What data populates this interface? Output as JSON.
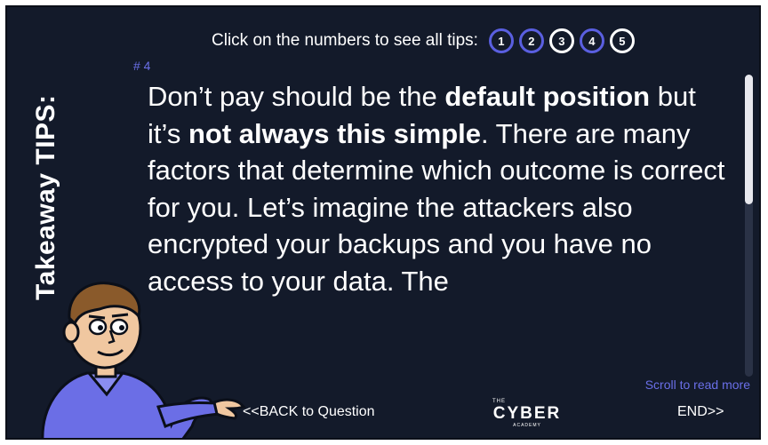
{
  "sidebar": {
    "title": "Takeaway TIPS:"
  },
  "header": {
    "label": "Click on the numbers to see all tips:",
    "numbers": [
      {
        "label": "1",
        "state": "current"
      },
      {
        "label": "2",
        "state": "current"
      },
      {
        "label": "3",
        "state": "visited"
      },
      {
        "label": "4",
        "state": "current"
      },
      {
        "label": "5",
        "state": "visited"
      }
    ]
  },
  "tip": {
    "number": "# 4",
    "parts": [
      "Don’t pay should be the ",
      "default position",
      " but it’s ",
      "not always this simple",
      ". There are many factors that determine which outcome is correct for you. Let’s imagine the attackers also encrypted your backups and you have no access to your data. The"
    ]
  },
  "scroll": {
    "hint": "Scroll to read more",
    "position": 0
  },
  "footer": {
    "back_label": "<<BACK to Question",
    "end_label": "END>>",
    "logo_top": "THE",
    "logo_main": "CYBER",
    "logo_bottom": "ACADEMY"
  },
  "colors": {
    "background": "#131a2a",
    "accent": "#5a5fe0",
    "text": "#ffffff",
    "character_shirt": "#6b6ee6"
  },
  "icons": {
    "character": "cartoon-presenter"
  }
}
